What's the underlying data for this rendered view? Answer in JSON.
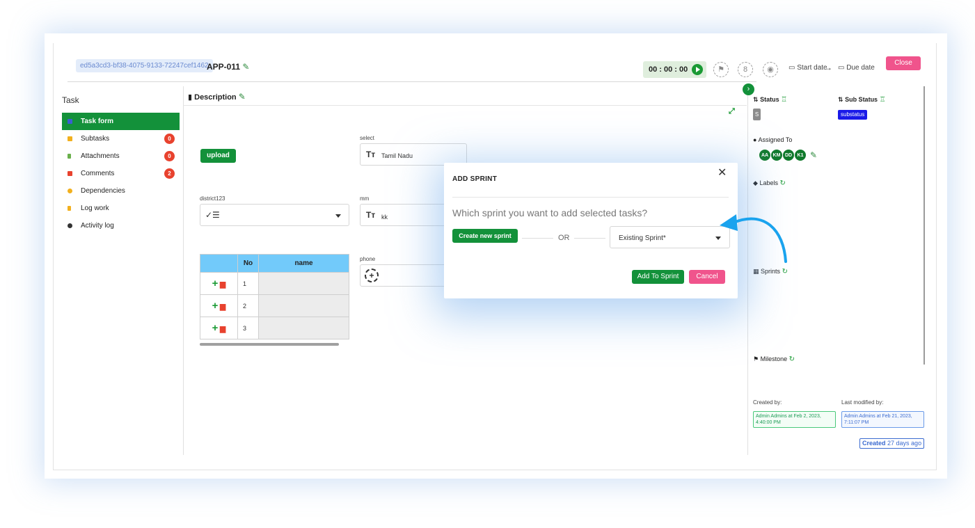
{
  "header": {
    "task_uuid": "ed5a3cd3-bf38-4075-9133-72247cef1462",
    "task_key": "APP-011",
    "timer": "00 : 00 : 00",
    "hourglass_glyph": "8",
    "start_date": "Start date",
    "due_date": "Due date",
    "arrow": "→",
    "close_label": "Close"
  },
  "sidebar": {
    "title": "Task",
    "items": [
      {
        "label": "Task form",
        "icon": "form-icon",
        "color": "#3a5fd0"
      },
      {
        "label": "Subtasks",
        "icon": "subtasks-icon",
        "color": "#f2b01e",
        "badge": "0"
      },
      {
        "label": "Attachments",
        "icon": "attachment-icon",
        "color": "#6ab04c",
        "badge": "0"
      },
      {
        "label": "Comments",
        "icon": "comment-icon",
        "color": "#e8422e",
        "badge": "2"
      },
      {
        "label": "Dependencies",
        "icon": "dependencies-icon",
        "color": "#f2b01e"
      },
      {
        "label": "Log work",
        "icon": "flag-icon",
        "color": "#f2b01e"
      },
      {
        "label": "Activity log",
        "icon": "activity-icon",
        "color": "#333333"
      }
    ]
  },
  "form": {
    "description_label": "Description",
    "upload_label": "upload",
    "select_label": "select",
    "select_value": "Tamil Nadu",
    "district_label": "district123",
    "district_glyph": "✓☰",
    "mm_label": "mm",
    "mm_value": "kk",
    "phone_label": "phone",
    "text_type_glyph": "Tт",
    "table": {
      "headers": [
        "",
        "No",
        "name"
      ],
      "rows": [
        {
          "no": "1",
          "name": ""
        },
        {
          "no": "2",
          "name": ""
        },
        {
          "no": "3",
          "name": ""
        }
      ]
    }
  },
  "right_panel": {
    "status_label": "Status",
    "status_value": "S",
    "sub_status_label": "Sub Status",
    "sub_status_value": "substatus",
    "assigned_label": "Assigned To",
    "assignees": [
      "AA",
      "KM",
      "DD",
      "K1"
    ],
    "labels_label": "Labels",
    "sprints_label": "Sprints",
    "milestone_label": "Milestone",
    "created_by_label": "Created by:",
    "created_by_value": "Admin Admins at Feb 2, 2023, 4:40:00 PM",
    "last_modified_label": "Last modified by:",
    "last_modified_value": "Admin Admins at Feb 21, 2023, 7:11:07 PM",
    "created_badge_bold": "Created",
    "created_badge_rest": "27 days ago"
  },
  "modal": {
    "title": "ADD SPRINT",
    "close_glyph": "✕",
    "question": "Which sprint you want to add selected tasks?",
    "create_label": "Create new sprint",
    "or_label": "OR",
    "existing_placeholder": "Existing Sprint*",
    "add_label": "Add To Sprint",
    "cancel_label": "Cancel"
  },
  "colors": {
    "brand_green": "#13913a",
    "accent_pink": "#f0548c",
    "table_header_blue": "#72cafa",
    "arrow_blue": "#1aa3ee",
    "substatus_blue": "#1a1ae8"
  }
}
